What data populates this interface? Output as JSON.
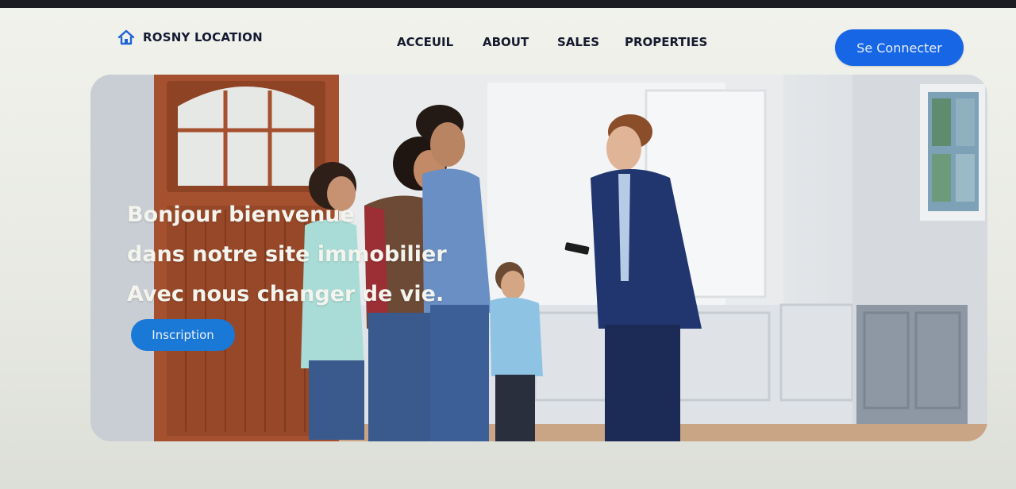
{
  "header": {
    "logo": {
      "icon": "home-icon",
      "text": "ROSNY LOCATION"
    },
    "nav": [
      {
        "label": "ACCEUIL"
      },
      {
        "label": "ABOUT"
      },
      {
        "label": "SALES"
      },
      {
        "label": "PROPERTIES"
      }
    ],
    "connect_label": "Se Connecter"
  },
  "hero": {
    "lines": [
      "Bonjour bienvenue",
      "dans notre site immobilier",
      "Avec nous changer de vie."
    ],
    "cta_label": "Inscription",
    "image": "hero-photo-family-with-real-estate-agent"
  },
  "colors": {
    "accent": "#1766e6",
    "cta": "#1a78d6",
    "nav_text": "#151a2e",
    "hero_text": "#f4f4ee"
  }
}
